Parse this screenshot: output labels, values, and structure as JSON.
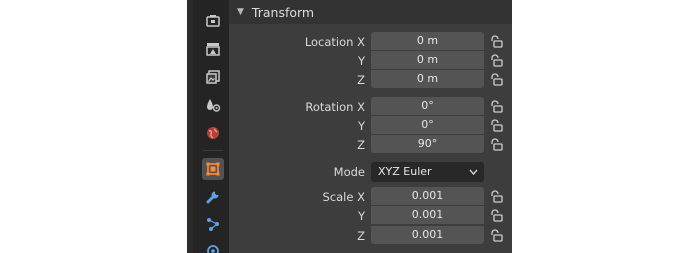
{
  "panel": {
    "title": "Transform"
  },
  "location": {
    "label": "Location X",
    "y_label": "Y",
    "z_label": "Z",
    "x": "0 m",
    "y": "0 m",
    "z": "0 m"
  },
  "rotation": {
    "label": "Rotation X",
    "y_label": "Y",
    "z_label": "Z",
    "x": "0°",
    "y": "0°",
    "z": "90°"
  },
  "mode": {
    "label": "Mode",
    "value": "XYZ Euler"
  },
  "scale": {
    "label": "Scale X",
    "y_label": "Y",
    "z_label": "Z",
    "x": "0.001",
    "y": "0.001",
    "z": "0.001"
  },
  "colors": {
    "active_tab_accent": "#ff8b3a",
    "field_bg": "#545454",
    "panel_bg": "#3d3d3d"
  },
  "tabs": [
    {
      "icon": "scene-icon"
    },
    {
      "icon": "render-icon"
    },
    {
      "icon": "view-layer-icon"
    },
    {
      "icon": "scene-properties-icon"
    },
    {
      "icon": "world-icon"
    },
    {
      "icon": "object-icon",
      "active": true
    },
    {
      "icon": "modifier-wrench-icon"
    },
    {
      "icon": "particles-icon"
    },
    {
      "icon": "physics-icon"
    }
  ]
}
